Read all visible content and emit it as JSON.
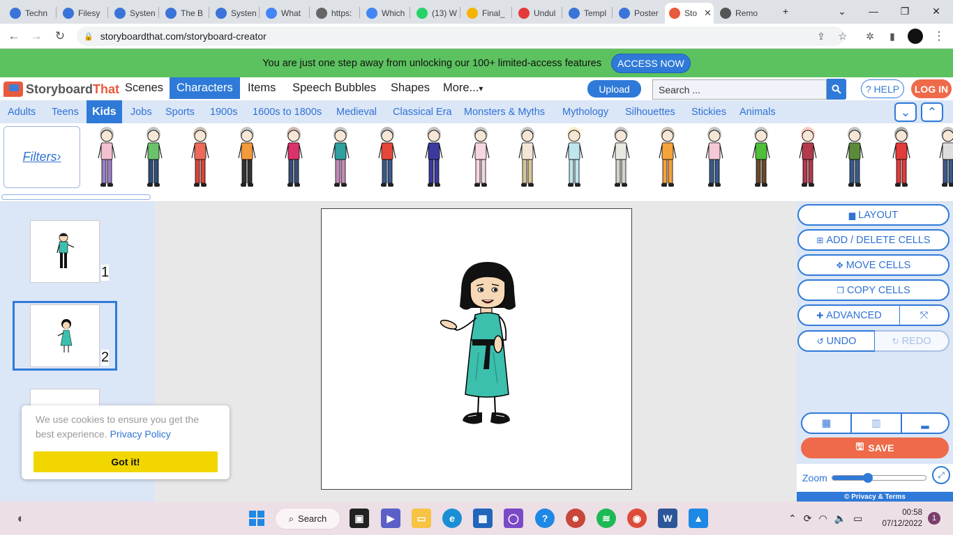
{
  "browser": {
    "tabs": [
      {
        "label": "Techn",
        "fav": "chrome-icon",
        "color": "#3b74d8"
      },
      {
        "label": "Filesy",
        "fav": "chrome-icon",
        "color": "#3b74d8"
      },
      {
        "label": "Systen",
        "fav": "chrome-icon",
        "color": "#3b74d8"
      },
      {
        "label": "The B",
        "fav": "chrome-icon",
        "color": "#3b74d8"
      },
      {
        "label": "Systen",
        "fav": "chrome-icon",
        "color": "#3b74d8"
      },
      {
        "label": "What",
        "fav": "google-icon",
        "color": "#4285f4"
      },
      {
        "label": "https:",
        "fav": "globe-icon",
        "color": "#666666"
      },
      {
        "label": "Which",
        "fav": "google-icon",
        "color": "#4285f4"
      },
      {
        "label": "(13) W",
        "fav": "whatsapp-icon",
        "color": "#25d366"
      },
      {
        "label": "Final_",
        "fav": "drive-icon",
        "color": "#f4b400"
      },
      {
        "label": "Undul",
        "fav": "heart-icon",
        "color": "#e33b3b"
      },
      {
        "label": "Templ",
        "fav": "canva-icon",
        "color": "#3b74d8"
      },
      {
        "label": "Poster",
        "fav": "canva-icon",
        "color": "#3b74d8"
      },
      {
        "label": "Sto",
        "fav": "storyboard-icon",
        "color": "#e85a3c",
        "active": true
      },
      {
        "label": "Remo",
        "fav": "layers-icon",
        "color": "#555555"
      }
    ],
    "url": "storyboardthat.com/storyboard-creator"
  },
  "promo": {
    "text": "You are just one step away from unlocking our 100+ limited-access features",
    "button": "ACCESS NOW"
  },
  "nav": {
    "logo_story": "Storyboard",
    "logo_that": "That",
    "items": [
      "Scenes",
      "Characters",
      "Items",
      "Speech Bubbles",
      "Shapes",
      "More..."
    ],
    "active": "Characters",
    "upload": "Upload",
    "search_placeholder": "Search ...",
    "help": "HELP",
    "login": "LOG IN"
  },
  "categories": [
    "Adults",
    "Teens",
    "Kids",
    "Jobs",
    "Sports",
    "1900s",
    "1600s to 1800s",
    "Medieval",
    "Classical Era",
    "Monsters & Myths",
    "Mythology",
    "Silhouettes",
    "Stickies",
    "Animals"
  ],
  "active_category": "Kids",
  "filters_label": "Filters›",
  "characters": [
    {
      "shirt": "#f3c0d0",
      "pants": "#9b7fc6",
      "hair": "#555555"
    },
    {
      "shirt": "#6cc26a",
      "pants": "#2f4f7a",
      "hair": "#555555"
    },
    {
      "shirt": "#ee6a5a",
      "pants": "#d9443a",
      "hair": "#6b4a2a"
    },
    {
      "shirt": "#f39a3a",
      "pants": "#333333",
      "hair": "#555555"
    },
    {
      "shirt": "#d9336a",
      "pants": "#3a4e7a",
      "hair": "#7a3a2a"
    },
    {
      "shirt": "#2f9f9f",
      "pants": "#c28ab8",
      "hair": "#555555"
    },
    {
      "shirt": "#e5483a",
      "pants": "#3a5a8a",
      "hair": "#333333"
    },
    {
      "shirt": "#3a3a9f",
      "pants": "#3a3a9f",
      "hair": "#555555"
    },
    {
      "shirt": "#f6d6e0",
      "pants": "#f6d6e0",
      "hair": "#555555"
    },
    {
      "shirt": "#f4e6d6",
      "pants": "#d8c69a",
      "hair": "#555555"
    },
    {
      "shirt": "#bfe6ee",
      "pants": "#bfe6ee",
      "hair": "#eecc66"
    },
    {
      "shirt": "#e9e9e2",
      "pants": "#d4d4cc",
      "hair": "#555555"
    },
    {
      "shirt": "#f6a33a",
      "pants": "#f6a33a",
      "hair": "#6b4a2a"
    },
    {
      "shirt": "#f6c9d6",
      "pants": "#3a5a8a",
      "hair": "#555555"
    },
    {
      "shirt": "#4fbf3a",
      "pants": "#6b4a2a",
      "hair": "#555555"
    },
    {
      "shirt": "#b33a4a",
      "pants": "#b33a4a",
      "hair": "#ee6a4a"
    },
    {
      "shirt": "#5a8a3a",
      "pants": "#3a5a8a",
      "hair": "#555555"
    },
    {
      "shirt": "#e33a3a",
      "pants": "#e33a3a",
      "hair": "#111111"
    },
    {
      "shirt": "#dddddd",
      "pants": "#3a5a8a",
      "hair": "#555555"
    }
  ],
  "cells": [
    {
      "number": "1"
    },
    {
      "number": "2",
      "selected": true
    }
  ],
  "right_panel": {
    "layout": "LAYOUT",
    "add_delete": "ADD / DELETE CELLS",
    "move": "MOVE CELLS",
    "copy": "COPY CELLS",
    "advanced": "ADVANCED",
    "undo": "UNDO",
    "redo": "REDO",
    "save": "SAVE",
    "zoom": "Zoom",
    "zoom_level": 0.38,
    "privacy": "© Privacy & Terms"
  },
  "cookie": {
    "text": "We use cookies to ensure you get the best experience.",
    "link": "Privacy Policy",
    "button": "Got it!"
  },
  "taskbar": {
    "search": "Search",
    "time": "00:58",
    "date": "07/12/2022",
    "notifications": "1"
  },
  "colors": {
    "accent": "#2f7ad8",
    "brand_orange": "#ee6a4a",
    "promo_green": "#5cc25f",
    "dress": "#3cbfad"
  }
}
